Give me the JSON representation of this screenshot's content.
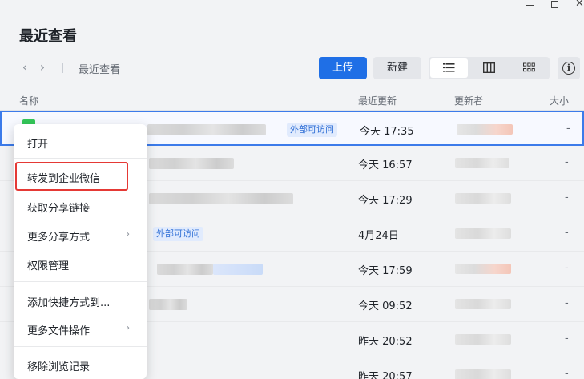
{
  "window": {
    "minimize": "—",
    "maximize": "□",
    "close": "✕"
  },
  "page": {
    "title": "最近查看"
  },
  "toolbar": {
    "back_icon": "‹",
    "forward_icon": "›",
    "breadcrumb": "最近查看",
    "upload_label": "上传",
    "new_label": "新建",
    "view_modes": [
      "list-view-icon",
      "column-view-icon",
      "grid-view-icon"
    ],
    "active_view": "list",
    "info_icon": "i"
  },
  "table": {
    "headers": {
      "name": "名称",
      "updated": "最近更新",
      "updater": "更新者",
      "size": "大小"
    },
    "rows": [
      {
        "name_badge": "外部可访问",
        "updated": "今天 17:35",
        "size": "-"
      },
      {
        "updated": "今天 16:57",
        "size": "-"
      },
      {
        "updated": "今天 17:29",
        "size": "-"
      },
      {
        "name_badge": "外部可访问",
        "updated": "4月24日",
        "size": "-"
      },
      {
        "updated": "今天 17:59",
        "size": "-"
      },
      {
        "updated": "今天 09:52",
        "size": "-"
      },
      {
        "updated": "昨天 20:52",
        "size": "-"
      },
      {
        "updated": "昨天 20:57",
        "size": "-"
      }
    ]
  },
  "context_menu": {
    "items": [
      {
        "label": "打开"
      },
      {
        "label": "转发到企业微信",
        "highlighted": true
      },
      {
        "label": "获取分享链接"
      },
      {
        "label": "更多分享方式",
        "arrow": "›"
      },
      {
        "label": "权限管理"
      },
      {
        "label": "添加快捷方式到..."
      },
      {
        "label": "更多文件操作",
        "arrow": "›"
      },
      {
        "label": "移除浏览记录"
      }
    ]
  },
  "colors": {
    "accent": "#1f6fe6",
    "highlight_border": "#e53935",
    "badge_bg": "#e1ebfd",
    "badge_text": "#2f6fd6"
  }
}
